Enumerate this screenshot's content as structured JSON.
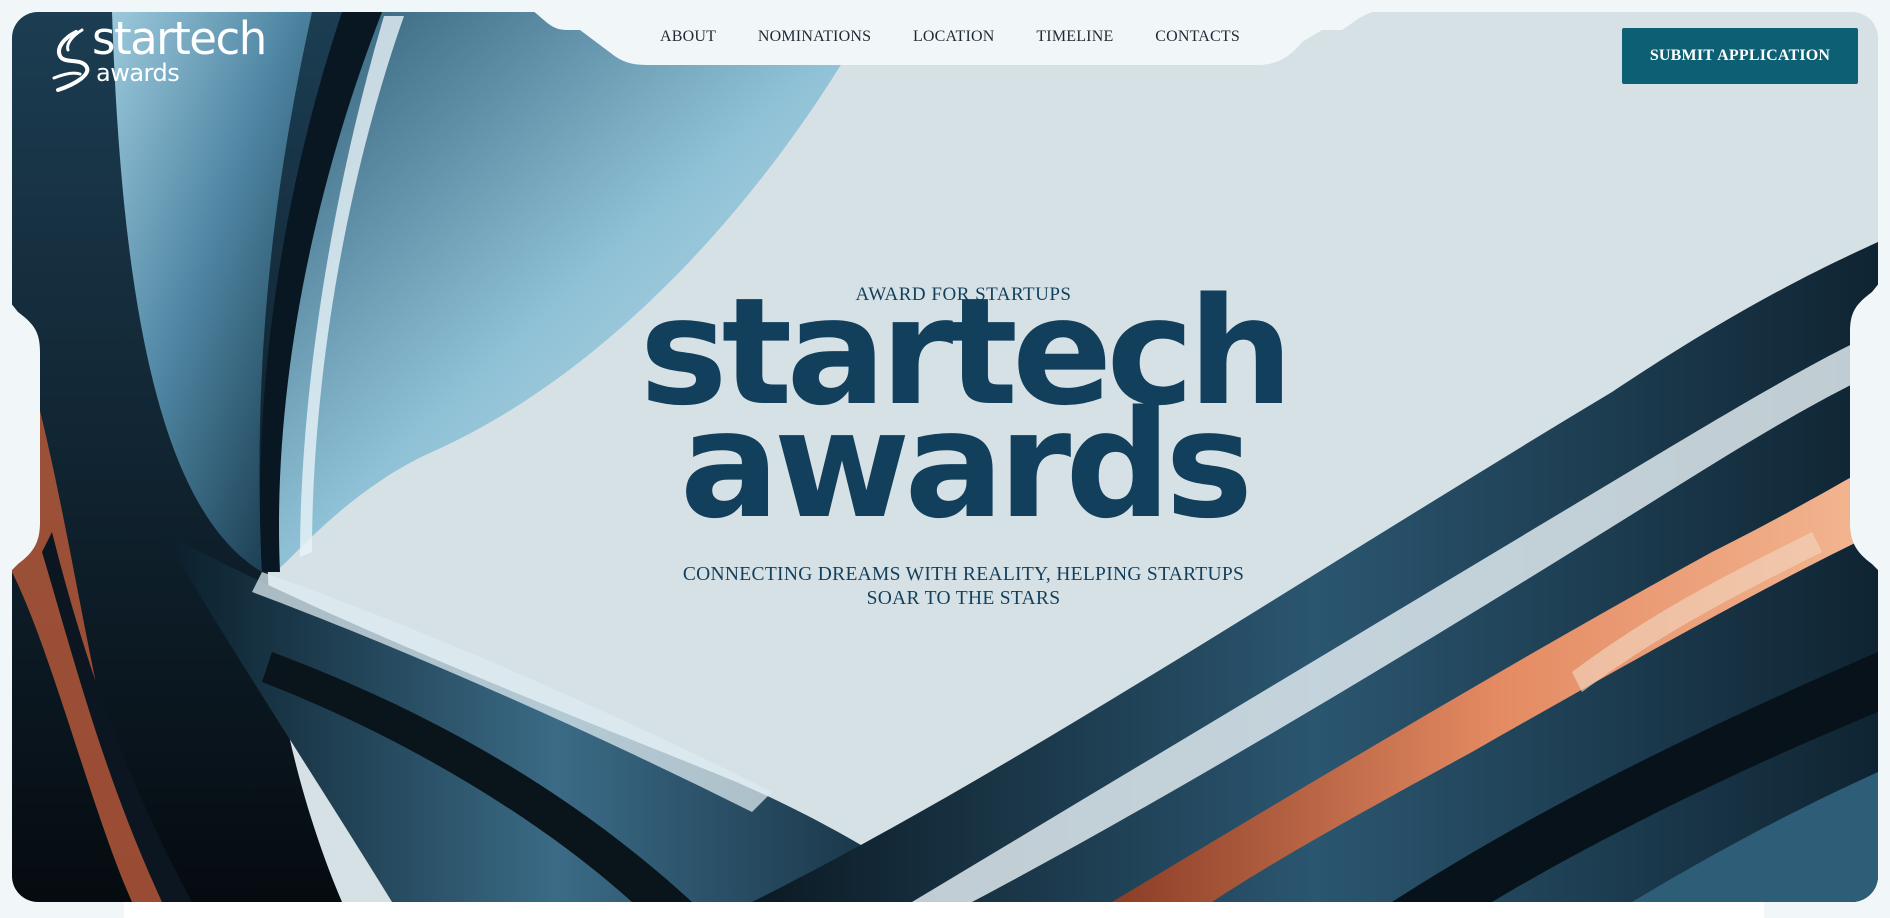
{
  "brand": {
    "logo_line1": "startech",
    "logo_line2": "awards",
    "logo_color": "#ffffff"
  },
  "nav": {
    "items": [
      {
        "label": "ABOUT"
      },
      {
        "label": "NOMINATIONS"
      },
      {
        "label": "LOCATION"
      },
      {
        "label": "TIMELINE"
      },
      {
        "label": "CONTACTS"
      }
    ]
  },
  "cta": {
    "label": "SUBMIT APPLICATION",
    "color": "#0d5f73"
  },
  "hero": {
    "eyebrow": "AWARD FOR STARTUPS",
    "title_line1": "startech",
    "title_line2": "awards",
    "subtitle_line1": "CONNECTING DREAMS WITH REALITY, HELPING STARTUPS",
    "subtitle_line2": "SOAR TO THE STARS",
    "text_color": "#123f5c",
    "background_color": "#d6e1e6"
  }
}
